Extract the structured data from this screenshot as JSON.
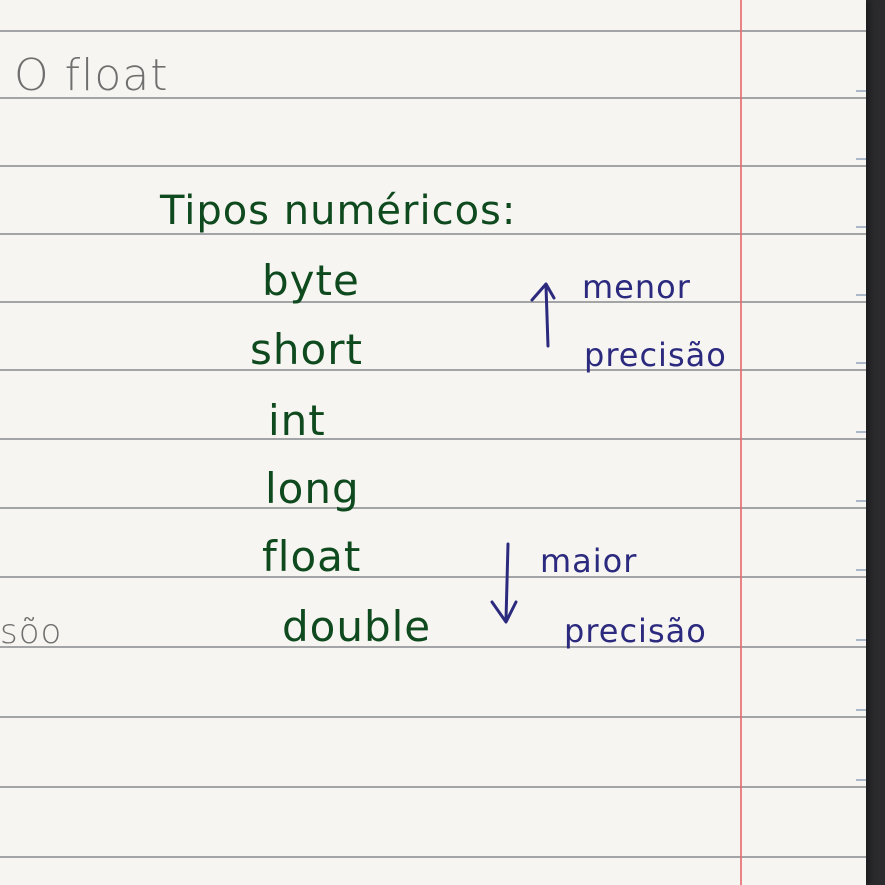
{
  "notebook": {
    "heading": "O float",
    "left_fragment": "sõo",
    "title": "Tipos numéricos:",
    "types": [
      "byte",
      "short",
      "int",
      "long",
      "float",
      "double"
    ],
    "annotation_low": {
      "line1": "menor",
      "line2": "precisão"
    },
    "annotation_high": {
      "line1": "maior",
      "line2": "precisão"
    },
    "colors": {
      "paper": "#f6f5f1",
      "green_ink": "#0f4a1f",
      "blue_ink": "#2c2a7e",
      "margin": "#e86f73",
      "pencil": "#6f6f6f"
    }
  }
}
